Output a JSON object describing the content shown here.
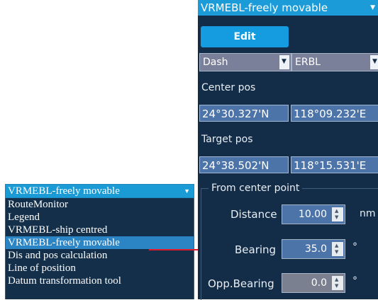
{
  "dropdown": {
    "selected": "VRMEBL-freely movable",
    "items": [
      "RouteMonitor",
      "Legend",
      "VRMEBL-ship centred",
      "VRMEBL-freely movable",
      "Dis and pos calculation",
      "Line of position",
      "Datum transformation tool"
    ],
    "highlighted_index": 3
  },
  "panel": {
    "title": "VRMEBL-freely movable",
    "edit_label": "Edit",
    "line_style": "Dash",
    "mode": "ERBL",
    "center_label": "Center pos",
    "center_lat": "24°30.327'N",
    "center_lon": "118°09.232'E",
    "target_label": "Target pos",
    "target_lat": "24°38.502'N",
    "target_lon": "118°15.531'E",
    "group_title": "From center point",
    "distance_label": "Distance",
    "distance_value": "10.00",
    "distance_unit": "nm",
    "bearing_label": "Bearing",
    "bearing_value": "35.0",
    "bearing_unit": "°",
    "opp_label": "Opp.Bearing",
    "opp_value": "0.0",
    "opp_unit": "°"
  },
  "colors": {
    "header_blue": "#1b9bd8",
    "panel_bg": "#132d48",
    "arrow_red": "#e0192b"
  },
  "icons": {
    "caret": "caret-down-icon",
    "spinner": "spinner-arrows-icon"
  }
}
